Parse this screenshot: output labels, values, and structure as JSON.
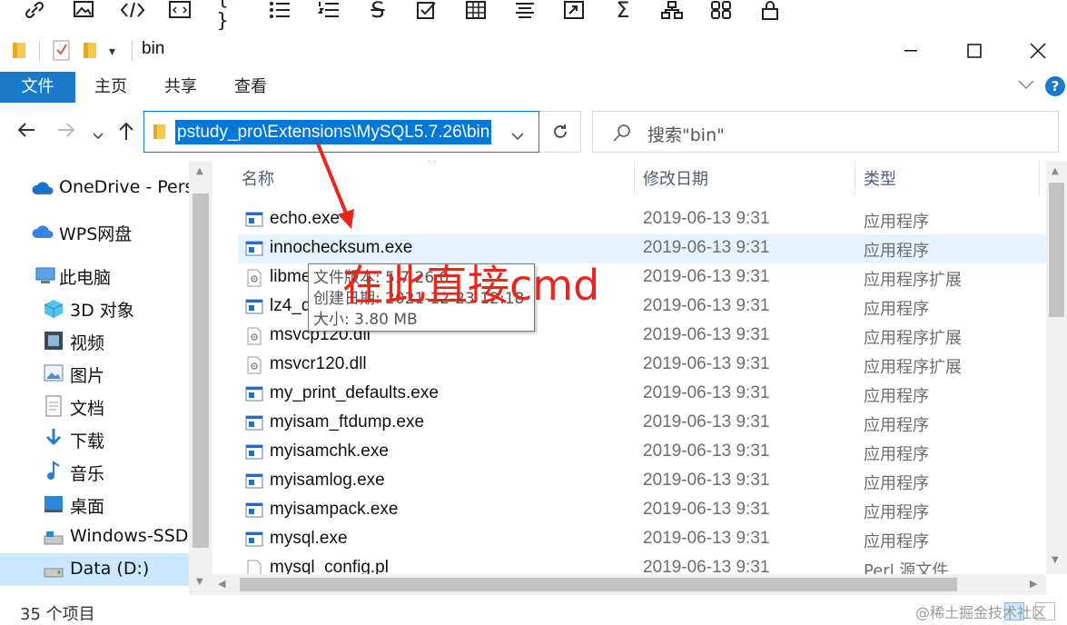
{
  "editor_toolbar": {
    "icons": [
      "link-icon",
      "image-icon",
      "code-icon",
      "code-block-icon",
      "braces-icon",
      "bulleted-list-icon",
      "numbered-list-icon",
      "strikethrough-icon",
      "checkbox-icon",
      "table-icon",
      "align-icon",
      "embed-icon",
      "sum-icon",
      "hierarchy-icon",
      "grid-icon",
      "lock-icon"
    ]
  },
  "titlebar": {
    "title": "bin"
  },
  "ribbon": {
    "file": "文件",
    "home": "主页",
    "share": "共享",
    "view": "查看"
  },
  "address": {
    "path": "pstudy_pro\\Extensions\\MySQL5.7.26\\bin",
    "search_placeholder": "搜索\"bin\""
  },
  "nav": {
    "items": [
      {
        "label": "OneDrive - Perso",
        "icon": "cloud-icon"
      },
      {
        "label": "WPS网盘",
        "icon": "cloud-icon"
      },
      {
        "label": "此电脑",
        "icon": "computer-icon"
      },
      {
        "label": "3D 对象",
        "icon": "cube-icon"
      },
      {
        "label": "视频",
        "icon": "video-icon"
      },
      {
        "label": "图片",
        "icon": "picture-icon"
      },
      {
        "label": "文档",
        "icon": "document-icon"
      },
      {
        "label": "下载",
        "icon": "download-icon"
      },
      {
        "label": "音乐",
        "icon": "music-icon"
      },
      {
        "label": "桌面",
        "icon": "desktop-icon"
      },
      {
        "label": "Windows-SSD (",
        "icon": "drive-icon"
      },
      {
        "label": "Data (D:)",
        "icon": "drive-icon"
      }
    ]
  },
  "columns": {
    "name": "名称",
    "date": "修改日期",
    "type": "类型"
  },
  "files": [
    {
      "name": "echo.exe",
      "date": "2019-06-13 9:31",
      "type": "应用程序",
      "kind": "exe"
    },
    {
      "name": "innochecksum.exe",
      "date": "2019-06-13 9:31",
      "type": "应用程序",
      "kind": "exe"
    },
    {
      "name": "libme",
      "date": "2019-06-13 9:31",
      "type": "应用程序扩展",
      "kind": "dll"
    },
    {
      "name": "lz4_d",
      "date": "2019-06-13 9:31",
      "type": "应用程序",
      "kind": "exe"
    },
    {
      "name": "msvcp120.dll",
      "date": "2019-06-13 9:31",
      "type": "应用程序扩展",
      "kind": "dll"
    },
    {
      "name": "msvcr120.dll",
      "date": "2019-06-13 9:31",
      "type": "应用程序扩展",
      "kind": "dll"
    },
    {
      "name": "my_print_defaults.exe",
      "date": "2019-06-13 9:31",
      "type": "应用程序",
      "kind": "exe"
    },
    {
      "name": "myisam_ftdump.exe",
      "date": "2019-06-13 9:31",
      "type": "应用程序",
      "kind": "exe"
    },
    {
      "name": "myisamchk.exe",
      "date": "2019-06-13 9:31",
      "type": "应用程序",
      "kind": "exe"
    },
    {
      "name": "myisamlog.exe",
      "date": "2019-06-13 9:31",
      "type": "应用程序",
      "kind": "exe"
    },
    {
      "name": "myisampack.exe",
      "date": "2019-06-13 9:31",
      "type": "应用程序",
      "kind": "exe"
    },
    {
      "name": "mysql.exe",
      "date": "2019-06-13 9:31",
      "type": "应用程序",
      "kind": "exe"
    },
    {
      "name": "mysql_config.pl",
      "date": "2019-06-13 9:31",
      "type": "Perl 源文件",
      "kind": "file"
    }
  ],
  "tooltip": {
    "line1": "文件版本: 5.7.26.0",
    "line2": "创建日期: 2021-12-23 12:18",
    "line3": "大小: 3.80 MB"
  },
  "annotation": "在此直接cmd",
  "status": {
    "count": "35 个项目"
  },
  "watermark": "@稀土掘金技术社区",
  "colors": {
    "accent": "#1979ca",
    "selection": "#0078d7",
    "annotation": "#e8261c"
  }
}
